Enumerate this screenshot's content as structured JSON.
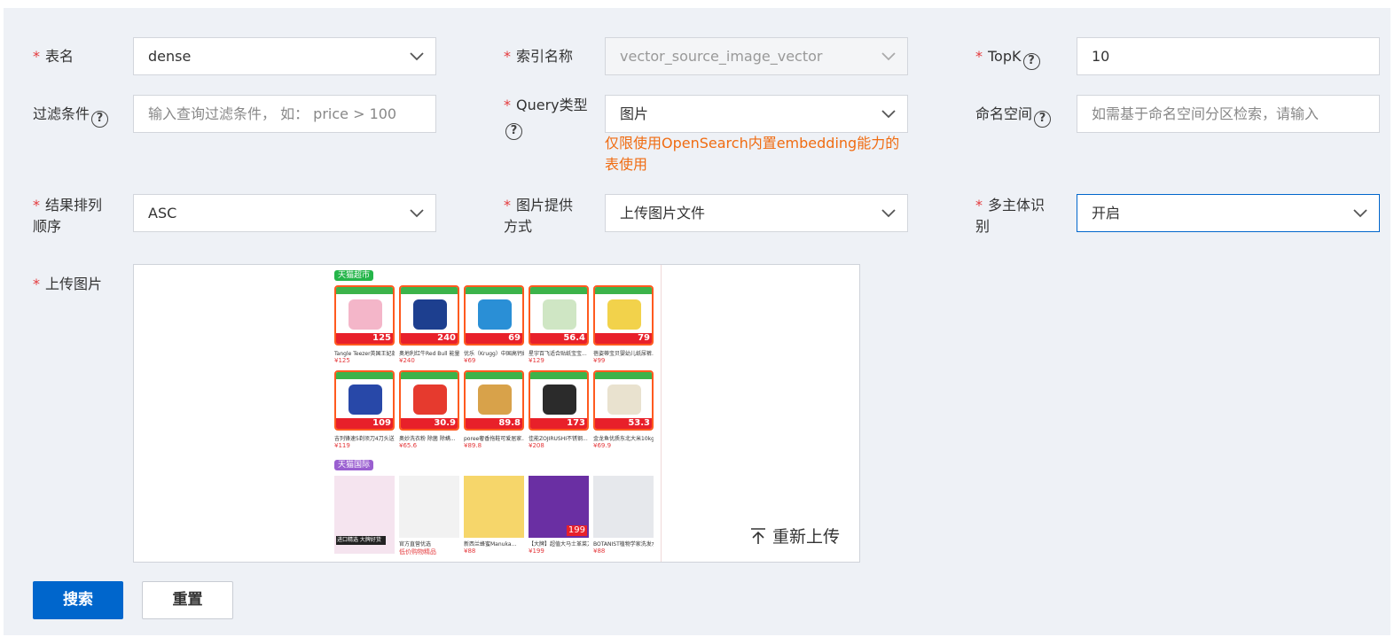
{
  "form": {
    "table_name": {
      "label": "表名",
      "value": "dense"
    },
    "index_name": {
      "label": "索引名称",
      "value": "vector_source_image_vector"
    },
    "topk": {
      "label": "TopK",
      "value": "10"
    },
    "filter": {
      "label": "过滤条件",
      "placeholder": "输入查询过滤条件， 如： price > 100"
    },
    "query_type": {
      "label": "Query类型",
      "value": "图片",
      "note": "仅限使用OpenSearch内置embedding能力的表使用"
    },
    "namespace": {
      "label": "命名空间",
      "placeholder": "如需基于命名空间分区检索，请输入"
    },
    "sort_order": {
      "label_line1": "结果排列",
      "label_line2": "顺序",
      "value": "ASC"
    },
    "image_source": {
      "label_line1": "图片提供",
      "label_line2": "方式",
      "value": "上传图片文件"
    },
    "multi_subject": {
      "label_line1": "多主体识",
      "label_line2": "别",
      "value": "开启"
    },
    "upload": {
      "label": "上传图片",
      "reupload": "重新上传"
    }
  },
  "preview": {
    "tag1": "天猫超市",
    "tag2": "天猫国际",
    "row1": [
      {
        "price": "125",
        "caption": "Tangle Teezer英国王妃款美...",
        "cprice": "¥125"
      },
      {
        "price": "240",
        "caption": "奥地利红牛Red Bull 能量饮...",
        "cprice": "¥240"
      },
      {
        "price": "69",
        "caption": "优乐（Krugg）中国高钙奶...",
        "cprice": "¥69"
      },
      {
        "price": "56.4",
        "caption": "星宇百飞适合贴纸宝宝...",
        "cprice": "¥129"
      },
      {
        "price": "79",
        "caption": "蓓姿蒂宝贝婴幼儿纸尿裤...",
        "cprice": "¥99"
      }
    ],
    "row2": [
      {
        "price": "109",
        "caption": "吉列锋速5剃须刀4刀头送...",
        "cprice": "¥119"
      },
      {
        "price": "30.9",
        "caption": "奥妙洗衣粉 除菌 除螨...",
        "cprice": "¥65.6"
      },
      {
        "price": "89.8",
        "caption": "poree奢香拖鞋可爱居家...",
        "cprice": "¥89.8"
      },
      {
        "price": "173",
        "caption": "佳能ZOJIRUSHI不锈钢...",
        "cprice": "¥208"
      },
      {
        "price": "53.3",
        "caption": "金龙鱼优质东北大米10kg...",
        "cprice": "¥69.9"
      }
    ],
    "row3": [
      {
        "caption": "进口精选 大牌好货",
        "cprice": ""
      },
      {
        "caption": "官方直营优选",
        "cprice": "低价购物精品"
      },
      {
        "caption": "新西兰蜂蜜Manuka...",
        "cprice": "¥88"
      },
      {
        "price": "199",
        "caption": "【大牌】超值大马士革菜刀...",
        "cprice": "¥199"
      },
      {
        "caption": "BOTANIST植物学家洗发水...",
        "cprice": "¥88"
      }
    ]
  },
  "actions": {
    "search": "搜索",
    "reset": "重置"
  },
  "colors": {
    "primary": "#0066cc",
    "required": "#e4393c",
    "warning": "#f06c12",
    "panel_bg": "#eef1f6"
  }
}
